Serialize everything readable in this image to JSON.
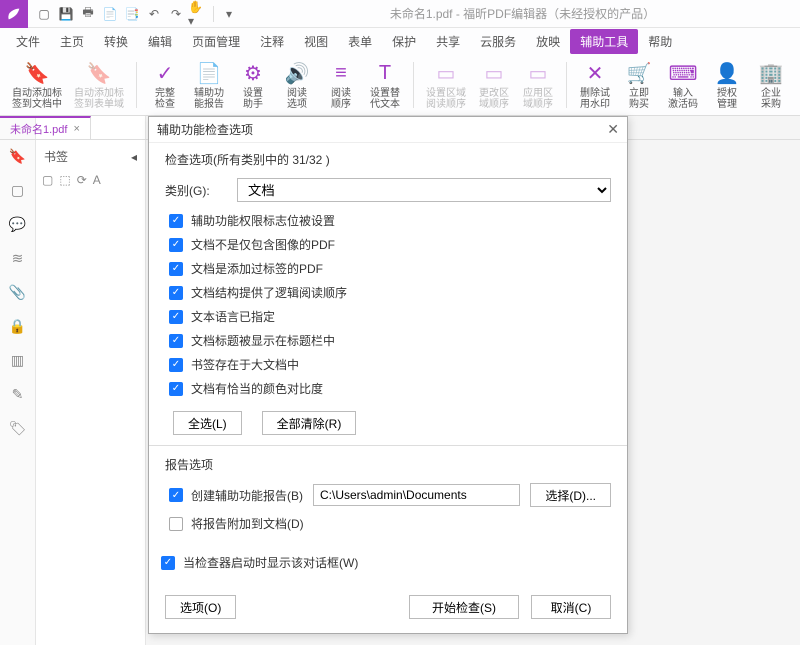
{
  "title": "未命名1.pdf - 福昕PDF编辑器（未经授权的产品）",
  "menus": [
    "文件",
    "主页",
    "转换",
    "编辑",
    "页面管理",
    "注释",
    "视图",
    "表单",
    "保护",
    "共享",
    "云服务",
    "放映",
    "辅助工具",
    "帮助"
  ],
  "activeMenu": 12,
  "ribbon": [
    {
      "label": "自动添加标\n签到文档中",
      "icon": "🔖"
    },
    {
      "label": "自动添加标\n签到表单域",
      "icon": "🔖",
      "disabled": true
    },
    {
      "label": "完整\n检查",
      "icon": "✓"
    },
    {
      "label": "辅助功\n能报告",
      "icon": "📄"
    },
    {
      "label": "设置\n助手",
      "icon": "⚙"
    },
    {
      "label": "阅读\n选项",
      "icon": "🔊"
    },
    {
      "label": "阅读\n顺序",
      "icon": "≡"
    },
    {
      "label": "设置替\n代文本",
      "icon": "T"
    },
    {
      "label": "设置区域\n阅读顺序",
      "icon": "▭",
      "disabled": true
    },
    {
      "label": "更改区\n域顺序",
      "icon": "▭",
      "disabled": true
    },
    {
      "label": "应用区\n域顺序",
      "icon": "▭",
      "disabled": true
    },
    {
      "label": "删除试\n用水印",
      "icon": "✕"
    },
    {
      "label": "立即\n购买",
      "icon": "🛒"
    },
    {
      "label": "输入\n激活码",
      "icon": "⌨"
    },
    {
      "label": "授权\n管理",
      "icon": "👤"
    },
    {
      "label": "企业\n采购",
      "icon": "🏢"
    }
  ],
  "tab": {
    "name": "未命名1.pdf"
  },
  "bookmarkPanel": {
    "title": "书签"
  },
  "dialog": {
    "title": "辅助功能检查选项",
    "checkHeader": "检查选项(所有类别中的 31/32 )",
    "categoryLabel": "类别(G):",
    "categoryValue": "文档",
    "checks": [
      "辅助功能权限标志位被设置",
      "文档不是仅包含图像的PDF",
      "文档是添加过标签的PDF",
      "文档结构提供了逻辑阅读顺序",
      "文本语言已指定",
      "文档标题被显示在标题栏中",
      "书签存在于大文档中",
      "文档有恰当的颜色对比度"
    ],
    "selectAll": "全选(L)",
    "clearAll": "全部清除(R)",
    "reportHeader": "报告选项",
    "createReport": "创建辅助功能报告(B)",
    "reportPath": "C:\\Users\\admin\\Documents",
    "browse": "选择(D)...",
    "attachReport": "将报告附加到文档(D)",
    "showOnStart": "当检查器启动时显示该对话框(W)",
    "options": "选项(O)",
    "start": "开始检查(S)",
    "cancel": "取消(C)"
  }
}
